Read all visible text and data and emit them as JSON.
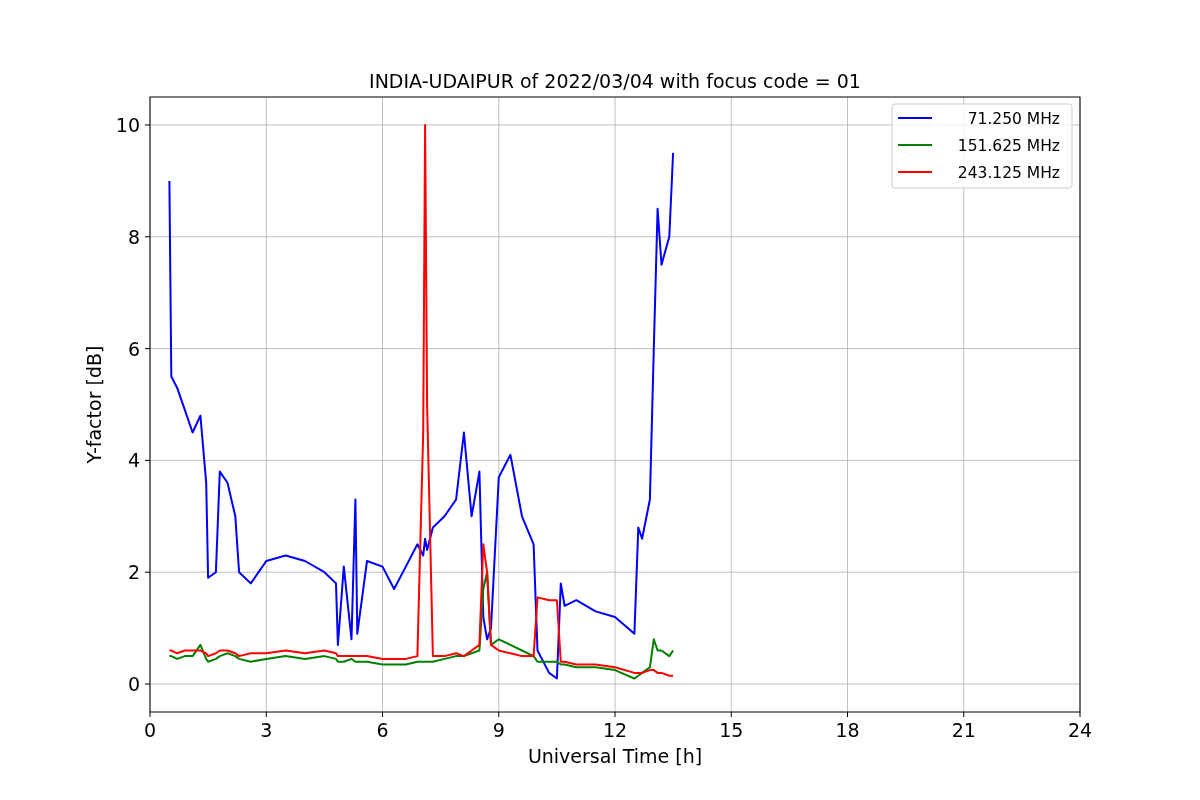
{
  "chart_data": {
    "type": "line",
    "title": "INDIA-UDAIPUR of 2022/03/04 with focus code = 01",
    "xlabel": "Universal Time [h]",
    "ylabel": "Y-factor [dB]",
    "x": [
      0.5,
      0.55,
      0.7,
      0.9,
      1.1,
      1.3,
      1.45,
      1.5,
      1.7,
      1.8,
      2.0,
      2.2,
      2.3,
      2.6,
      3.0,
      3.5,
      4.0,
      4.5,
      4.8,
      4.85,
      5.0,
      5.2,
      5.3,
      5.35,
      5.6,
      6.0,
      6.3,
      6.6,
      6.9,
      7.05,
      7.1,
      7.15,
      7.3,
      7.6,
      7.9,
      8.1,
      8.3,
      8.5,
      8.6,
      8.7,
      8.8,
      9.0,
      9.3,
      9.6,
      9.9,
      10.0,
      10.3,
      10.5,
      10.6,
      10.7,
      11.0,
      11.5,
      12.0,
      12.5,
      12.6,
      12.7,
      12.9,
      13.0,
      13.1,
      13.2,
      13.4,
      13.5
    ],
    "series": [
      {
        "name": "71.250 MHz",
        "color": "#0000ff",
        "values": [
          9.0,
          5.5,
          5.3,
          4.9,
          4.5,
          4.8,
          3.6,
          1.9,
          2.0,
          3.8,
          3.6,
          3.0,
          2.0,
          1.8,
          2.2,
          2.3,
          2.2,
          2.0,
          1.8,
          0.7,
          2.1,
          0.8,
          3.3,
          0.9,
          2.2,
          2.1,
          1.7,
          2.1,
          2.5,
          2.3,
          2.6,
          2.4,
          2.8,
          3.0,
          3.3,
          4.5,
          3.0,
          3.8,
          1.2,
          0.8,
          1.0,
          3.7,
          4.1,
          3.0,
          2.5,
          0.6,
          0.2,
          0.1,
          1.8,
          1.4,
          1.5,
          1.3,
          1.2,
          0.9,
          2.8,
          2.6,
          3.3,
          6.0,
          8.5,
          7.5,
          8.0,
          9.5
        ]
      },
      {
        "name": "151.625 MHz",
        "color": "#008000",
        "values": [
          0.5,
          0.5,
          0.45,
          0.5,
          0.5,
          0.7,
          0.45,
          0.4,
          0.45,
          0.5,
          0.55,
          0.5,
          0.45,
          0.4,
          0.45,
          0.5,
          0.45,
          0.5,
          0.45,
          0.4,
          0.4,
          0.45,
          0.4,
          0.4,
          0.4,
          0.35,
          0.35,
          0.35,
          0.4,
          0.4,
          0.4,
          0.4,
          0.4,
          0.45,
          0.5,
          0.5,
          0.55,
          0.6,
          1.7,
          2.0,
          0.7,
          0.8,
          0.7,
          0.6,
          0.5,
          0.4,
          0.4,
          0.4,
          0.35,
          0.35,
          0.3,
          0.3,
          0.25,
          0.1,
          0.15,
          0.2,
          0.3,
          0.8,
          0.6,
          0.6,
          0.5,
          0.6
        ]
      },
      {
        "name": "243.125 MHz",
        "color": "#ff0000",
        "values": [
          0.6,
          0.6,
          0.55,
          0.6,
          0.6,
          0.6,
          0.55,
          0.5,
          0.55,
          0.6,
          0.6,
          0.55,
          0.5,
          0.55,
          0.55,
          0.6,
          0.55,
          0.6,
          0.55,
          0.5,
          0.5,
          0.5,
          0.5,
          0.5,
          0.5,
          0.45,
          0.45,
          0.45,
          0.5,
          4.5,
          10.0,
          5.0,
          0.5,
          0.5,
          0.55,
          0.5,
          0.6,
          0.7,
          2.5,
          2.0,
          0.7,
          0.6,
          0.55,
          0.5,
          0.5,
          1.55,
          1.5,
          1.5,
          0.4,
          0.4,
          0.35,
          0.35,
          0.3,
          0.2,
          0.2,
          0.2,
          0.25,
          0.25,
          0.2,
          0.2,
          0.15,
          0.15
        ]
      }
    ],
    "grid": true,
    "legend": true,
    "xlim": [
      0,
      24
    ],
    "ylim": [
      -0.5,
      10.5
    ],
    "xticks": [
      0,
      3,
      6,
      9,
      12,
      15,
      18,
      21,
      24
    ],
    "yticks": [
      0,
      2,
      4,
      6,
      8,
      10
    ]
  }
}
